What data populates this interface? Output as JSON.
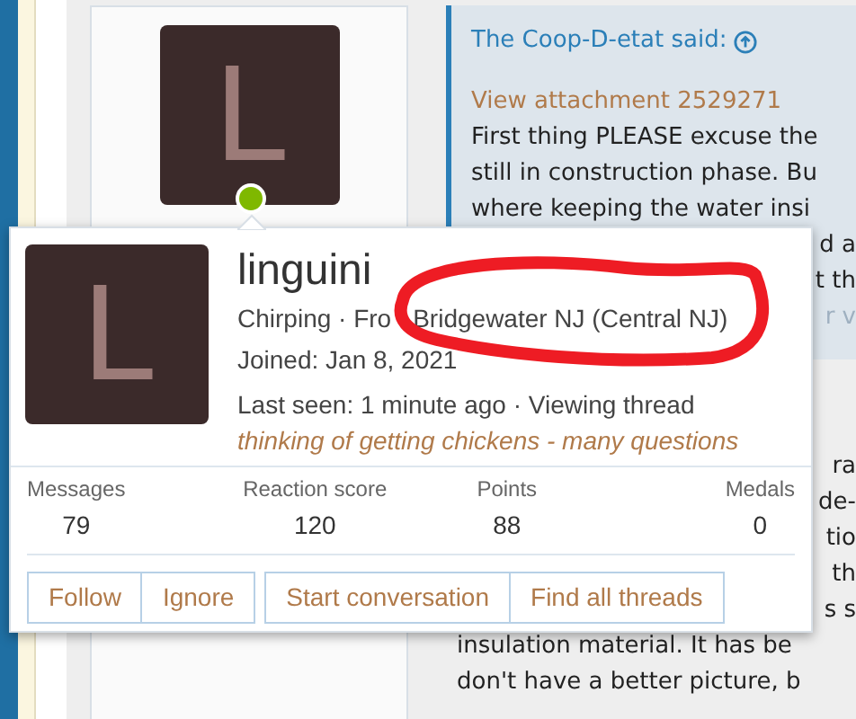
{
  "post": {
    "avatar_letter": "L",
    "quote": {
      "author": "The Coop-D-etat said:",
      "attachment": "View attachment 2529271",
      "lines": [
        "First thing PLEASE excuse the",
        "still in construction phase. Bu",
        "where keeping the water insi",
        "d a",
        "t th",
        "r v"
      ]
    },
    "body_lines": [
      "ra",
      "de-",
      "tio",
      "th",
      "s s",
      "insulation material. It has be",
      "don't have a better picture, b"
    ]
  },
  "popup": {
    "avatar_letter": "L",
    "username": "linguini",
    "title": "Chirping · Fro",
    "location": "Bridgewater NJ (Central NJ)",
    "joined": "Joined: Jan 8, 2021",
    "last_seen": "Last seen: 1 minute ago · Viewing thread",
    "status": "thinking of getting chickens - many questions",
    "online": true,
    "stats": [
      {
        "label": "Messages",
        "value": "79"
      },
      {
        "label": "Reaction score",
        "value": "120"
      },
      {
        "label": "Points",
        "value": "88"
      },
      {
        "label": "Medals",
        "value": "0"
      }
    ],
    "button_groups": [
      [
        "Follow",
        "Ignore"
      ],
      [
        "Start conversation",
        "Find all threads"
      ]
    ]
  }
}
